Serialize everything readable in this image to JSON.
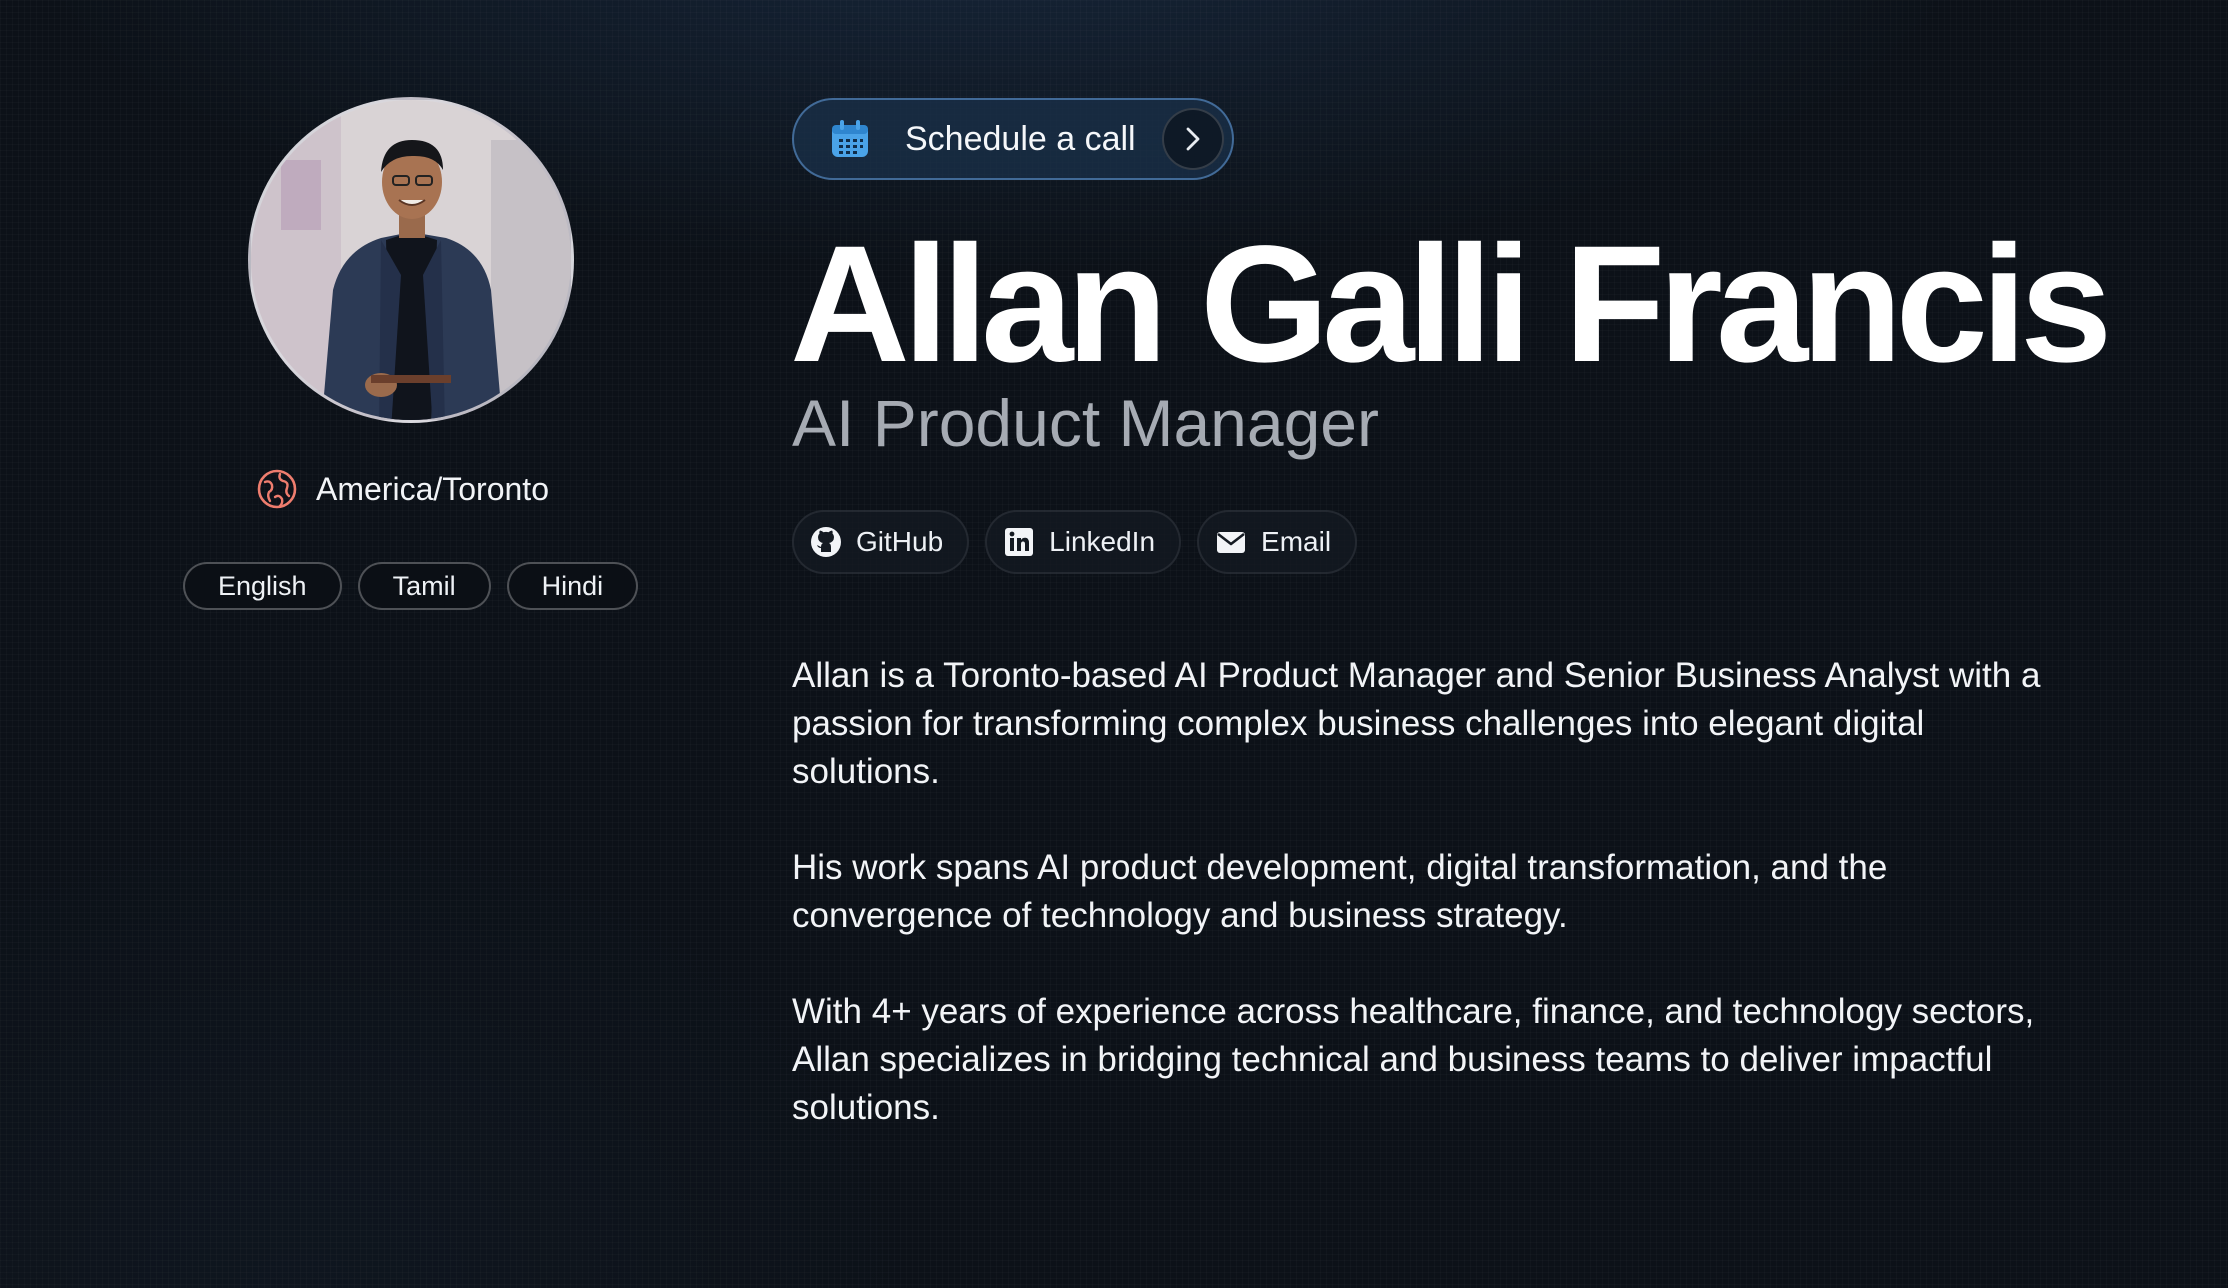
{
  "profile": {
    "name": "Allan Galli Francis",
    "role": "AI Product Manager",
    "location": "America/Toronto",
    "location_icon": "globe-icon",
    "languages": [
      "English",
      "Tamil",
      "Hindi"
    ]
  },
  "cta": {
    "label": "Schedule a call",
    "icon": "calendar-icon",
    "arrow_icon": "chevron-right-icon"
  },
  "socials": [
    {
      "label": "GitHub",
      "icon": "github-icon"
    },
    {
      "label": "LinkedIn",
      "icon": "linkedin-icon"
    },
    {
      "label": "Email",
      "icon": "mail-icon"
    }
  ],
  "bio": [
    "Allan is a Toronto-based AI Product Manager and Senior Business Analyst with a passion for transforming complex business challenges into elegant digital solutions.",
    "His work spans AI product development, digital transformation, and the convergence of technology and business strategy.",
    "With 4+ years of experience across healthcare, finance, and technology sectors, Allan specializes in bridging technical and business teams to deliver impactful solutions."
  ],
  "colors": {
    "background": "#0c1118",
    "accent_blue": "#4aa3e8",
    "globe": "#ee7d6e",
    "role_text": "#a6abb3"
  }
}
